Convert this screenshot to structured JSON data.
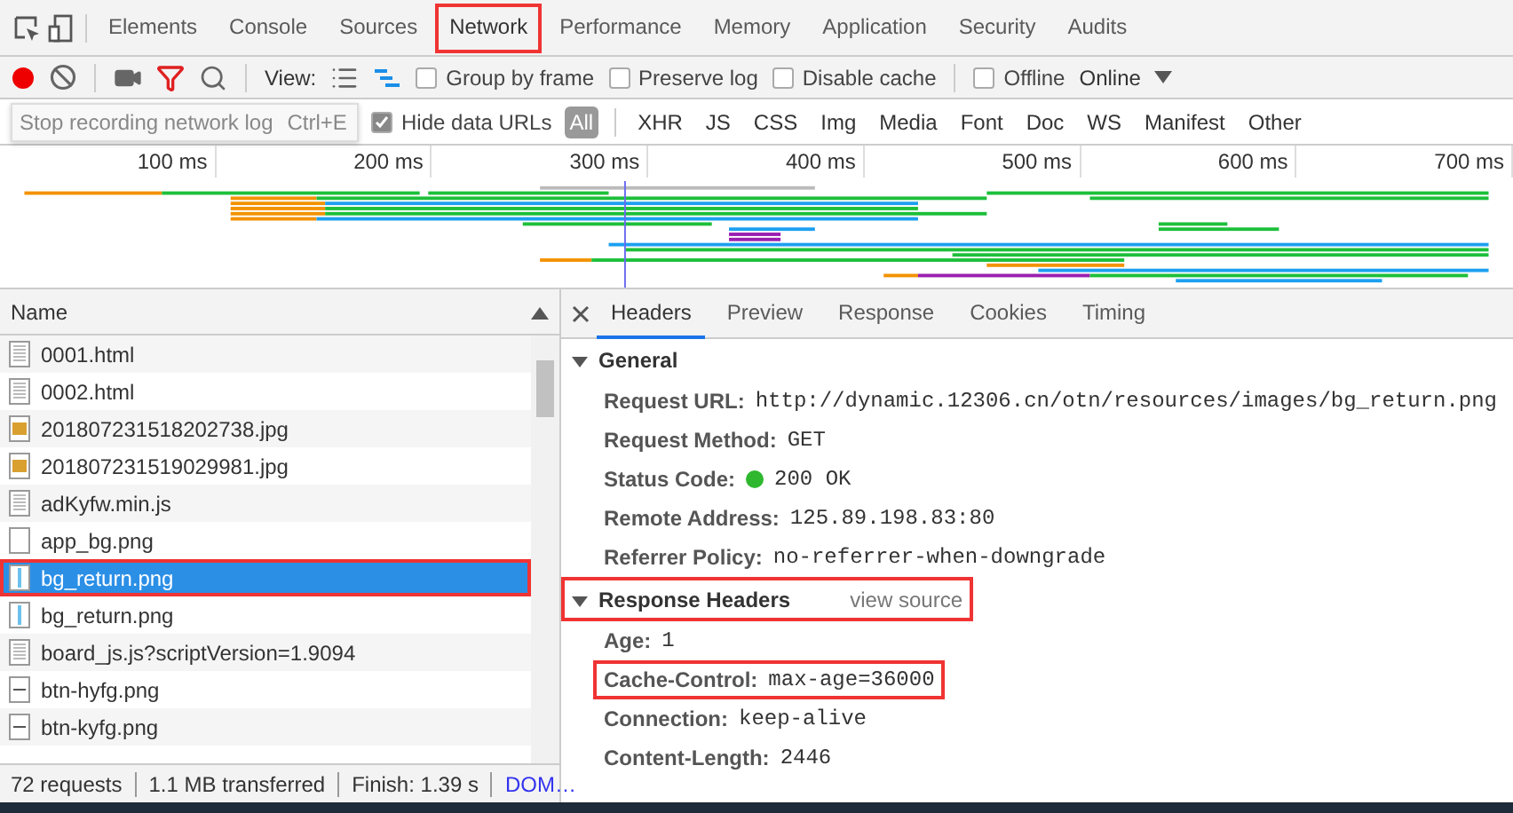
{
  "main_tabs": [
    {
      "label": "Elements",
      "selected": false,
      "annotated": false
    },
    {
      "label": "Console",
      "selected": false,
      "annotated": false
    },
    {
      "label": "Sources",
      "selected": false,
      "annotated": false
    },
    {
      "label": "Network",
      "selected": true,
      "annotated": true
    },
    {
      "label": "Performance",
      "selected": false,
      "annotated": false
    },
    {
      "label": "Memory",
      "selected": false,
      "annotated": false
    },
    {
      "label": "Application",
      "selected": false,
      "annotated": false
    },
    {
      "label": "Security",
      "selected": false,
      "annotated": false
    },
    {
      "label": "Audits",
      "selected": false,
      "annotated": false
    }
  ],
  "toolbar": {
    "recording": true,
    "view_label": "View:",
    "checkboxes": [
      {
        "label": "Group by frame",
        "checked": false
      },
      {
        "label": "Preserve log",
        "checked": false
      },
      {
        "label": "Disable cache",
        "checked": false
      },
      {
        "label": "Offline",
        "checked": false
      }
    ],
    "throttle": "Online"
  },
  "filter_bar": {
    "tooltip": "Stop recording network log",
    "shortcut": "Ctrl+E",
    "hide_data_urls": {
      "label": "Hide data URLs",
      "checked": true
    },
    "types": [
      {
        "label": "All",
        "selected": true
      },
      {
        "label": "XHR",
        "selected": false
      },
      {
        "label": "JS",
        "selected": false
      },
      {
        "label": "CSS",
        "selected": false
      },
      {
        "label": "Img",
        "selected": false
      },
      {
        "label": "Media",
        "selected": false
      },
      {
        "label": "Font",
        "selected": false
      },
      {
        "label": "Doc",
        "selected": false
      },
      {
        "label": "WS",
        "selected": false
      },
      {
        "label": "Manifest",
        "selected": false
      },
      {
        "label": "Other",
        "selected": false
      }
    ]
  },
  "overview": {
    "ticks": [
      "100 ms",
      "200 ms",
      "300 ms",
      "400 ms",
      "500 ms",
      "600 ms",
      "700 ms"
    ]
  },
  "requests": {
    "column": "Name",
    "rows": [
      {
        "name": "0001.html",
        "kind": "doc",
        "selected": false,
        "annotated": false
      },
      {
        "name": "0002.html",
        "kind": "doc",
        "selected": false,
        "annotated": false
      },
      {
        "name": "201807231518202738.jpg",
        "kind": "photo",
        "selected": false,
        "annotated": false
      },
      {
        "name": "201807231519029981.jpg",
        "kind": "photo",
        "selected": false,
        "annotated": false
      },
      {
        "name": "adKyfw.min.js",
        "kind": "doc",
        "selected": false,
        "annotated": false
      },
      {
        "name": "app_bg.png",
        "kind": "blank",
        "selected": false,
        "annotated": false
      },
      {
        "name": "bg_return.png",
        "kind": "image",
        "selected": true,
        "annotated": true
      },
      {
        "name": "bg_return.png",
        "kind": "image",
        "selected": false,
        "annotated": false
      },
      {
        "name": "board_js.js?scriptVersion=1.9094",
        "kind": "doc",
        "selected": false,
        "annotated": false
      },
      {
        "name": "btn-hyfg.png",
        "kind": "line",
        "selected": false,
        "annotated": false
      },
      {
        "name": "btn-kyfg.png",
        "kind": "line",
        "selected": false,
        "annotated": false
      }
    ]
  },
  "detail_tabs": [
    {
      "label": "Headers",
      "selected": true
    },
    {
      "label": "Preview",
      "selected": false
    },
    {
      "label": "Response",
      "selected": false
    },
    {
      "label": "Cookies",
      "selected": false
    },
    {
      "label": "Timing",
      "selected": false
    }
  ],
  "general": {
    "title": "General",
    "expanded": true,
    "fields": [
      {
        "label": "Request URL:",
        "value": "http://dynamic.12306.cn/otn/resources/images/bg_return.png"
      },
      {
        "label": "Request Method:",
        "value": "GET"
      },
      {
        "label": "Status Code:",
        "value": "200 OK",
        "color": "#2fb82f"
      },
      {
        "label": "Remote Address:",
        "value": "125.89.198.83:80"
      },
      {
        "label": "Referrer Policy:",
        "value": "no-referrer-when-downgrade"
      }
    ]
  },
  "response_headers": {
    "title": "Response Headers",
    "link": "view source",
    "expanded": true,
    "annotated": true,
    "fields": [
      {
        "label": "Age:",
        "value": "1",
        "annotated": false
      },
      {
        "label": "Cache-Control:",
        "value": "max-age=36000",
        "annotated": true
      },
      {
        "label": "Connection:",
        "value": "keep-alive",
        "annotated": false
      },
      {
        "label": "Content-Length:",
        "value": "2446",
        "annotated": false
      }
    ]
  },
  "status_bar": {
    "items": [
      "72 requests",
      "1.1 MB transferred",
      "Finish: 1.39 s"
    ],
    "link": "DOM…"
  }
}
